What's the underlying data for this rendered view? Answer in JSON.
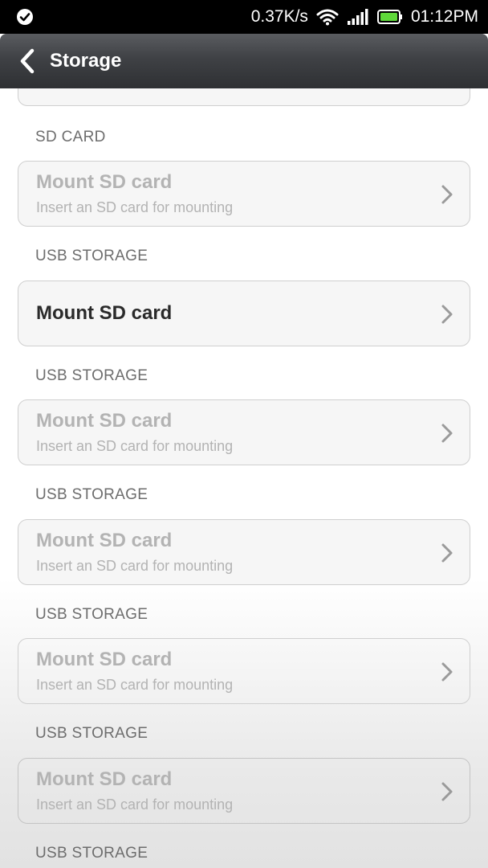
{
  "status_bar": {
    "speed": "0.37K/s",
    "time": "01:12PM",
    "left_icon": "check-circle-icon",
    "wifi_icon": "wifi-icon",
    "signal_icon": "signal-icon",
    "battery_icon": "battery-icon"
  },
  "header": {
    "title": "Storage",
    "back_icon": "back-arrow-icon"
  },
  "sections": [
    {
      "label": "SD CARD",
      "item": {
        "title": "Mount SD card",
        "subtitle": "Insert an SD card for mounting",
        "enabled": false
      }
    },
    {
      "label": "USB STORAGE",
      "item": {
        "title": "Mount SD card",
        "subtitle": "",
        "enabled": true
      }
    },
    {
      "label": "USB STORAGE",
      "item": {
        "title": "Mount SD card",
        "subtitle": "Insert an SD card for mounting",
        "enabled": false
      }
    },
    {
      "label": "USB STORAGE",
      "item": {
        "title": "Mount SD card",
        "subtitle": "Insert an SD card for mounting",
        "enabled": false
      }
    },
    {
      "label": "USB STORAGE",
      "item": {
        "title": "Mount SD card",
        "subtitle": "Insert an SD card for mounting",
        "enabled": false
      }
    },
    {
      "label": "USB STORAGE",
      "item": {
        "title": "Mount SD card",
        "subtitle": "Insert an SD card for mounting",
        "enabled": false
      }
    },
    {
      "label": "USB STORAGE"
    }
  ]
}
